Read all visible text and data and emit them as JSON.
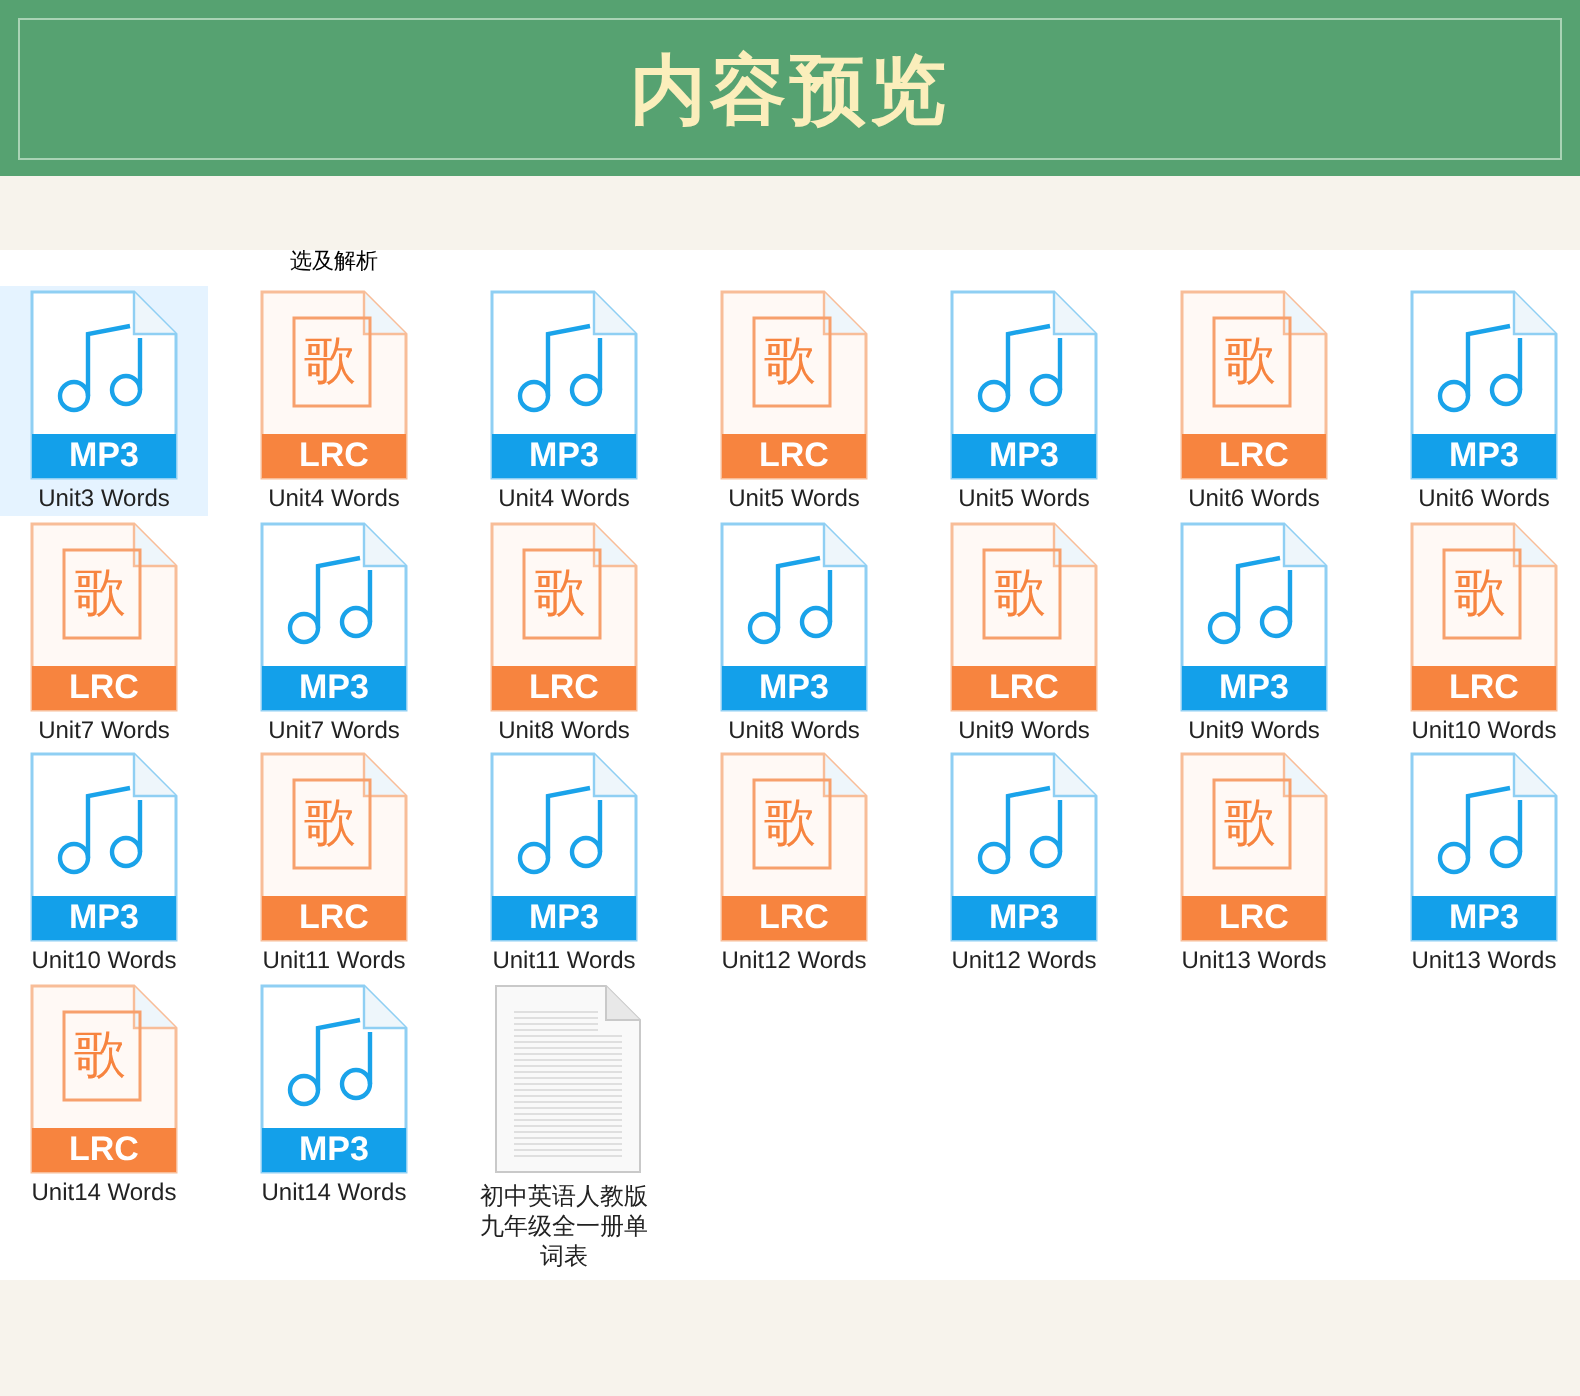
{
  "header": {
    "title": "内容预览"
  },
  "partial_caption": "选及解析",
  "files": [
    {
      "kind": "mp3",
      "badge": "MP3",
      "name": "Unit3 Words",
      "selected": true
    },
    {
      "kind": "lrc",
      "badge": "LRC",
      "glyph": "歌",
      "name": "Unit4 Words",
      "selected": false
    },
    {
      "kind": "mp3",
      "badge": "MP3",
      "name": "Unit4 Words",
      "selected": false
    },
    {
      "kind": "lrc",
      "badge": "LRC",
      "glyph": "歌",
      "name": "Unit5 Words",
      "selected": false
    },
    {
      "kind": "mp3",
      "badge": "MP3",
      "name": "Unit5 Words",
      "selected": false
    },
    {
      "kind": "lrc",
      "badge": "LRC",
      "glyph": "歌",
      "name": "Unit6 Words",
      "selected": false
    },
    {
      "kind": "mp3",
      "badge": "MP3",
      "name": "Unit6 Words",
      "selected": false
    },
    {
      "kind": "lrc",
      "badge": "LRC",
      "glyph": "歌",
      "name": "Unit7 Words",
      "selected": false
    },
    {
      "kind": "mp3",
      "badge": "MP3",
      "name": "Unit7 Words",
      "selected": false
    },
    {
      "kind": "lrc",
      "badge": "LRC",
      "glyph": "歌",
      "name": "Unit8 Words",
      "selected": false
    },
    {
      "kind": "mp3",
      "badge": "MP3",
      "name": "Unit8 Words",
      "selected": false
    },
    {
      "kind": "lrc",
      "badge": "LRC",
      "glyph": "歌",
      "name": "Unit9 Words",
      "selected": false
    },
    {
      "kind": "mp3",
      "badge": "MP3",
      "name": "Unit9 Words",
      "selected": false
    },
    {
      "kind": "lrc",
      "badge": "LRC",
      "glyph": "歌",
      "name": "Unit10 Words",
      "selected": false
    },
    {
      "kind": "mp3",
      "badge": "MP3",
      "name": "Unit10 Words",
      "selected": false
    },
    {
      "kind": "lrc",
      "badge": "LRC",
      "glyph": "歌",
      "name": "Unit11 Words",
      "selected": false
    },
    {
      "kind": "mp3",
      "badge": "MP3",
      "name": "Unit11 Words",
      "selected": false
    },
    {
      "kind": "lrc",
      "badge": "LRC",
      "glyph": "歌",
      "name": "Unit12 Words",
      "selected": false
    },
    {
      "kind": "mp3",
      "badge": "MP3",
      "name": "Unit12 Words",
      "selected": false
    },
    {
      "kind": "lrc",
      "badge": "LRC",
      "glyph": "歌",
      "name": "Unit13 Words",
      "selected": false
    },
    {
      "kind": "mp3",
      "badge": "MP3",
      "name": "Unit13 Words",
      "selected": false
    },
    {
      "kind": "lrc",
      "badge": "LRC",
      "glyph": "歌",
      "name": "Unit14 Words",
      "selected": false
    },
    {
      "kind": "mp3",
      "badge": "MP3",
      "name": "Unit14 Words",
      "selected": false
    },
    {
      "kind": "doc",
      "name": "初中英语人教版九年级全一册单词表",
      "selected": false
    }
  ]
}
